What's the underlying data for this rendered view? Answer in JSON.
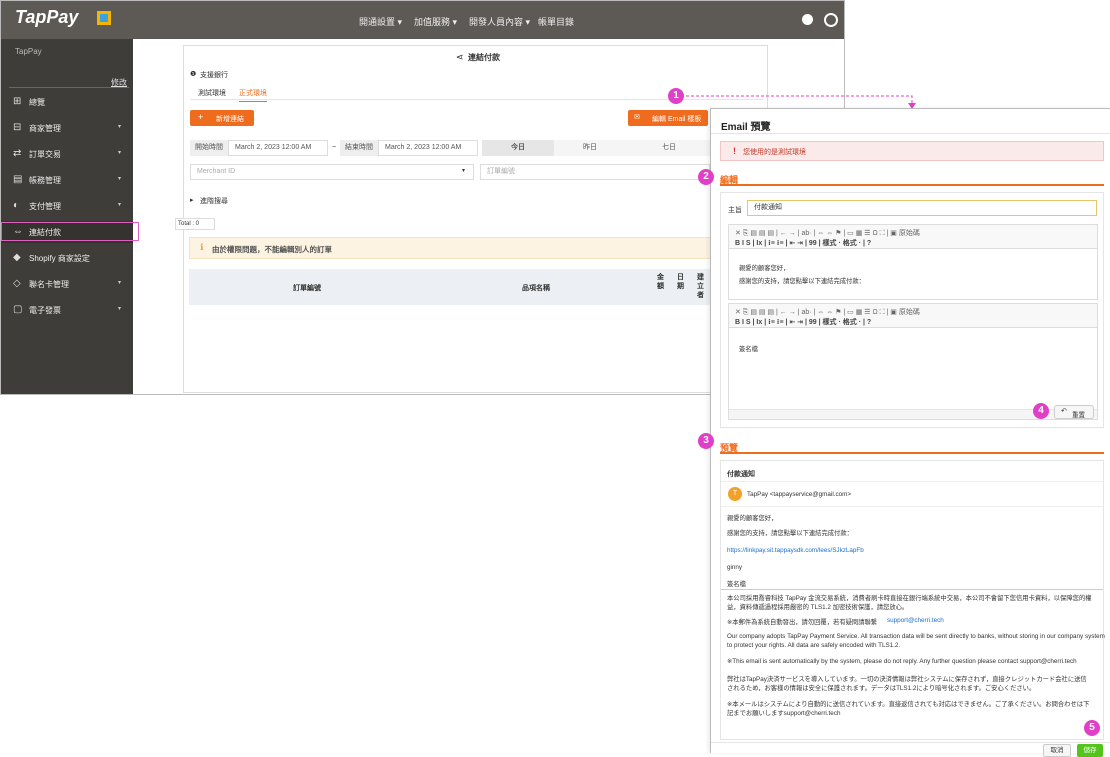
{
  "app": {
    "logo": "TapPay",
    "nav": [
      "開通設置 ▾",
      "加值服務 ▾",
      "開發人員內容 ▾",
      "帳單目錄"
    ],
    "sidebar": {
      "merchant": "TapPay",
      "edit": "修改",
      "items": [
        {
          "icon": "⊞",
          "label": "總覽",
          "caret": ""
        },
        {
          "icon": "⊟",
          "label": "商家管理",
          "caret": "▾"
        },
        {
          "icon": "⇄",
          "label": "訂單交易",
          "caret": "▾"
        },
        {
          "icon": "▤",
          "label": "帳務管理",
          "caret": "▾"
        },
        {
          "icon": "◐",
          "label": "支付管理",
          "caret": "▾"
        },
        {
          "icon": "⇔",
          "label": "連結付款",
          "caret": ""
        },
        {
          "icon": "◆",
          "label": "Shopify 商家設定",
          "caret": ""
        },
        {
          "icon": "◇",
          "label": "聯名卡管理",
          "caret": "▾"
        },
        {
          "icon": "▢",
          "label": "電子發票",
          "caret": "▾"
        }
      ]
    },
    "content": {
      "title": "連結付款",
      "bank_label": "支援銀行",
      "tabs": [
        "測試環境",
        "正式環境"
      ],
      "add_button": "新增連結",
      "email_button": "編輯 Email 樣板",
      "start_label": "開始時間",
      "start_value": "March 2, 2023 12:00 AM",
      "end_label": "結束時間",
      "end_value": "March 2, 2023 12:00 AM",
      "date_tabs": [
        "今日",
        "昨日",
        "七日"
      ],
      "merchant_placeholder": "Merchant ID",
      "order_placeholder": "訂單編號",
      "advanced": "進階搜尋",
      "total": "Total : 0",
      "warning": "由於權限問題，不能編輯別人的訂單",
      "columns": [
        "訂單編號",
        "品項名稱",
        "金額",
        "日期",
        "建立者"
      ]
    }
  },
  "modal": {
    "title": "Email 預覽",
    "alert": "您使用的是測試環境",
    "edit_section": "編輯",
    "subject_label": "主旨",
    "subject_value": "付款通知",
    "toolbar_row1": "✕ ⎘ ▤ ▤ ▤ | ← → | ab· | ⇔ ⇔ ⚑ | ▭ ▦ ☰ Ω ⛶ | ▣ 原始碼",
    "toolbar_row2": "B  I  S  | Ix | ⁝≡ ⁝≡ | ⇤ ⇥ | 99 |  樣式      ·  格式      ·  |  ?",
    "editor1_lines": [
      "親愛的顧客您好，",
      "感謝您的支持，請您點擊以下連結完成付款："
    ],
    "editor2_line": "簽名檔",
    "reset_button": "重置",
    "preview_section": "預覽",
    "preview": {
      "subject": "付款通知",
      "avatar_letter": "T",
      "sender": "TapPay <tappayservice@gmail.com>",
      "greeting": "親愛的顧客您好，",
      "thanks": "感謝您的支持，請您點擊以下連結完成付款：",
      "link": "https://linkpay.sit.tappaysdk.com/lees/SJkzLapFb",
      "name": "ginny",
      "signature": "簽名檔",
      "zh1": "本公司採用喬睿科技 TapPay 金流交易系統，消費者刷卡時直接在銀行端系統中交易，本公司不會留下您信用卡資料，以保障您的權",
      "zh2": "益，資料傳遞過程採用嚴密的 TLS1.2 加密技術保護，請您放心。",
      "zh3a": "※本郵件為系統自動發出，請勿回覆，若有疑問請聯繫 ",
      "zh3b": "support@cherri.tech",
      "en1": "Our company adopts TapPay Payment Service. All transaction data will be sent directly to banks, without storing in our company system",
      "en2": "to protect your rights. All data are safely encoded with TLS1.2.",
      "en3": "※This email is sent automatically by the system, please do not reply. Any further question please contact support@cherri.tech",
      "ja1": "弊社はTapPay決済サービスを導入しています。一切の決済情報は弊社システムに保存されず，直接クレジットカード会社に送信",
      "ja2": "されるため，お客様の情報は安全に保護されます。データはTLS1.2により暗号化されます。ご安心ください。",
      "ja3": "※本メールはシステムにより自動的に送信されています。直接返信されても対応はできません。ご了承ください。お問合わせは下",
      "ja4": "記までお願いしますsupport@cherri.tech"
    },
    "cancel_button": "取消",
    "save_button": "儲存"
  },
  "badges": [
    "1",
    "2",
    "3",
    "4",
    "5"
  ],
  "colors": {
    "accent": "#ef6c1f",
    "badge": "#e040c8",
    "save": "#52c41a",
    "sidebar": "#3f3d3a",
    "topbar": "#5d5a55"
  }
}
